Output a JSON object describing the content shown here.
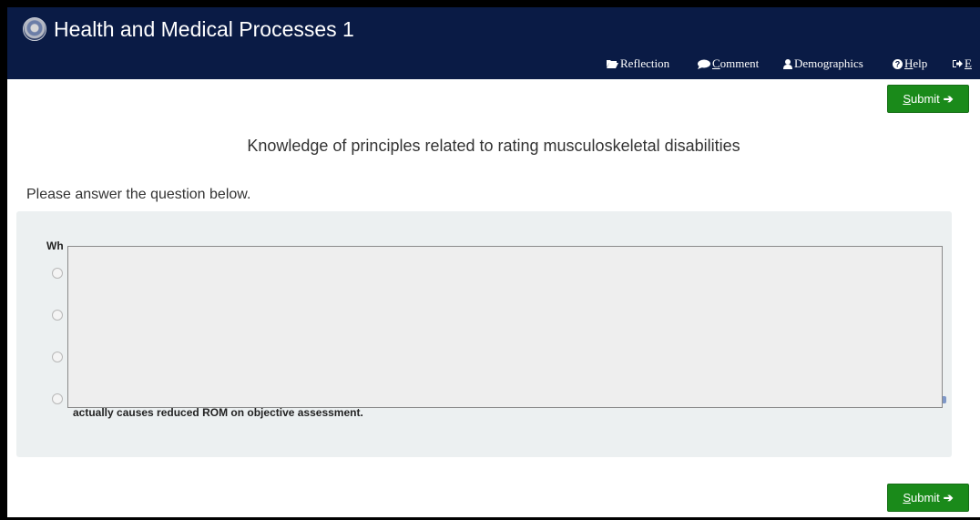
{
  "header": {
    "title": "Health and Medical Processes 1",
    "logo_icon": "va-seal-icon",
    "nav": [
      {
        "icon": "folder-open-icon",
        "label": "Reflection",
        "underline": ""
      },
      {
        "icon": "comment-icon",
        "label": "Comment",
        "underline": "C"
      },
      {
        "icon": "user-icon",
        "label": "Demographics",
        "underline": ""
      },
      {
        "icon": "question-circle-icon",
        "label": "Help",
        "underline": "H"
      },
      {
        "icon": "exit-icon",
        "label": "E",
        "underline": "E"
      }
    ]
  },
  "actions": {
    "submit_label": "Submit",
    "submit_underline": "S",
    "submit_icon": "arrow-right-icon"
  },
  "page": {
    "heading": "Knowledge of principles related to rating musculoskeletal disabilities",
    "instruction": "Please answer the question below."
  },
  "question": {
    "text_visible": "Wh",
    "options_count": 4,
    "last_option_tail": "actually causes reduced ROM on objective assessment."
  },
  "colors": {
    "header_bg": "#0a1b45",
    "submit_bg": "#1a8a1a",
    "panel_bg": "#ecf0f1"
  }
}
